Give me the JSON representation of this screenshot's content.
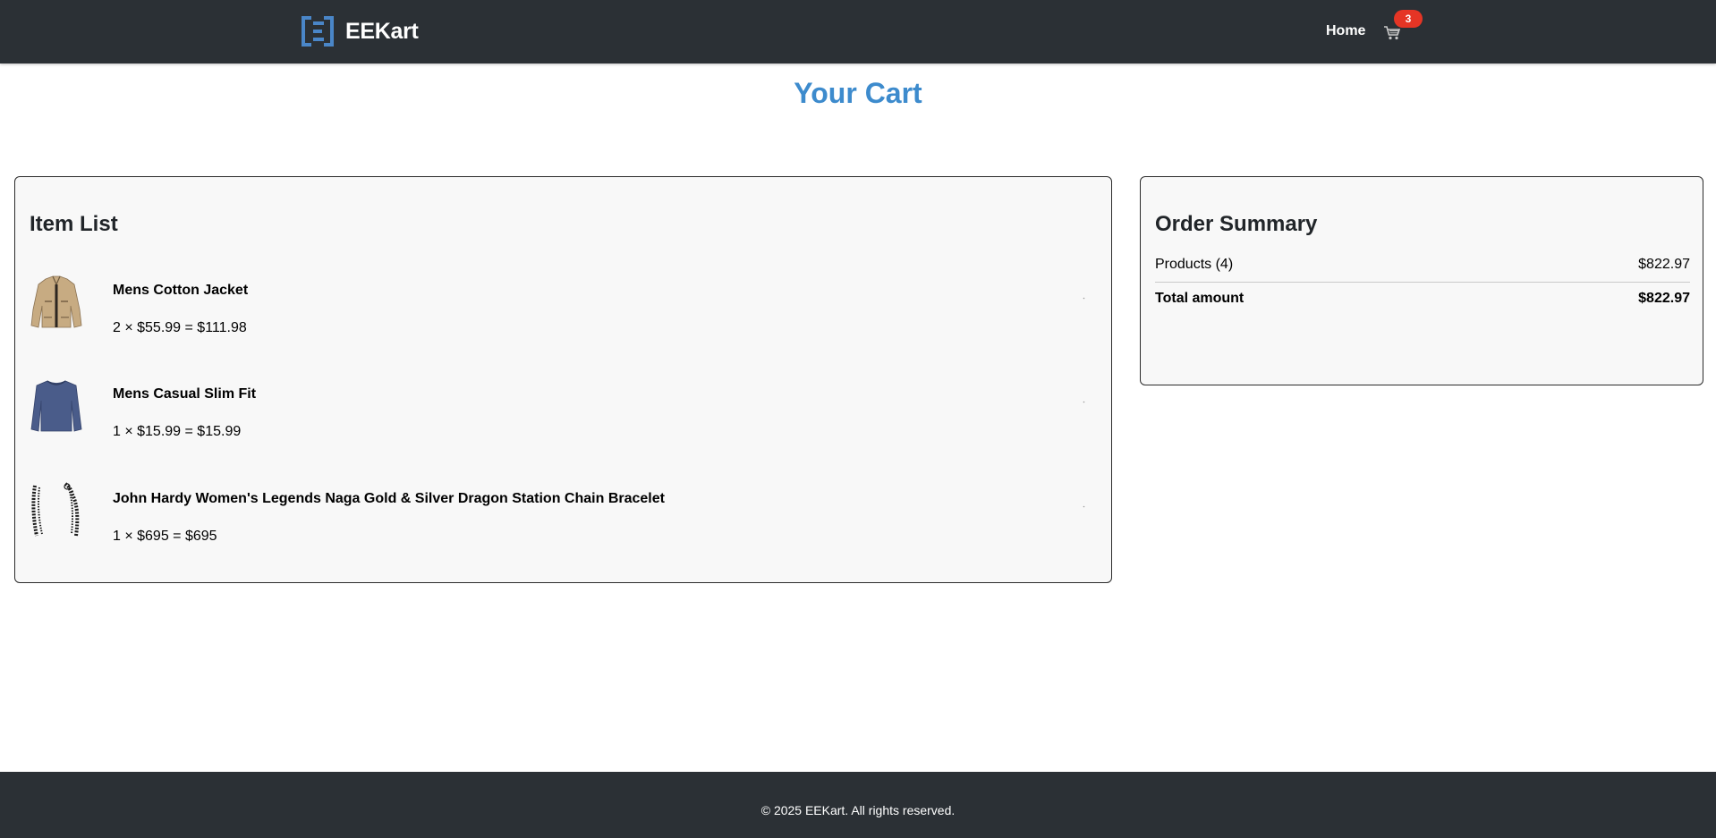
{
  "brand": {
    "name": "EEKart",
    "logo_icon": "bracket-e-logo",
    "logo_color": "#4a86c8"
  },
  "nav": {
    "home_label": "Home",
    "cart_icon": "cart-icon",
    "cart_count": "3"
  },
  "page": {
    "title": "Your Cart"
  },
  "item_list": {
    "heading": "Item List",
    "items": [
      {
        "name": "Mens Cotton Jacket",
        "price_line": "2 × $55.99 = $111.98",
        "thumb_icon": "jacket-image"
      },
      {
        "name": "Mens Casual Slim Fit",
        "price_line": "1 × $15.99 = $15.99",
        "thumb_icon": "shirt-image"
      },
      {
        "name": "John Hardy Women's Legends Naga Gold & Silver Dragon Station Chain Bracelet",
        "price_line": "1 × $695 = $695",
        "thumb_icon": "bracelet-image"
      }
    ]
  },
  "summary": {
    "heading": "Order Summary",
    "products_label": "Products (4)",
    "products_value": "$822.97",
    "total_label": "Total amount",
    "total_value": "$822.97"
  },
  "footer": {
    "text": "© 2025 EEKart. All rights reserved."
  },
  "colors": {
    "navbar": "#2b3035",
    "accent": "#3d8bcd",
    "badge": "#e53525",
    "card_bg": "#f8f8f8"
  }
}
